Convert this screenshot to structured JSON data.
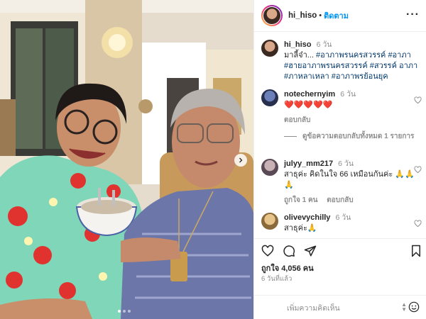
{
  "post": {
    "username": "hi_hiso",
    "follow_label": "ติดตาม",
    "separator": "•"
  },
  "caption": {
    "username": "hi_hiso",
    "time": "6 วัน",
    "text_prefix": "มาลี้จ๋า...",
    "hashtags": [
      "#อาภาพรนครสวรรค์",
      "#อาภา",
      "#ฮายอาภาพรนครสวรรค์",
      "#สวรรค์",
      "อาภา",
      "#ภาหลาเหลา",
      "#อาภาพรย้อนยุค"
    ]
  },
  "comments": [
    {
      "username": "notechernyim",
      "time": "6 วัน",
      "text": "❤️❤️❤️❤️❤️",
      "reply_label": "ตอบกลับ",
      "view_replies": "ดูข้อความตอบกลับทั้งหมด 1 รายการ"
    },
    {
      "username": "julyy_mm217",
      "time": "6 วัน",
      "text": "สาธุค่ะ คิดในใจ 66 เหมือนกันค่ะ 🙏🙏🙏",
      "likes": "ถูกใจ 1 คน",
      "reply_label": "ตอบกลับ"
    },
    {
      "username": "olivevychilly",
      "time": "6 วัน",
      "text": "สาธุค่ะ🙏"
    }
  ],
  "actions": {
    "likes_text": "ถูกใจ 4,056 คน",
    "posted_ago": "6 วันที่แล้ว"
  },
  "add_comment": {
    "placeholder": "เพิ่มความคิดเห็น"
  },
  "icons": {
    "more": "more-options-icon",
    "like": "heart-icon",
    "comment": "comment-icon",
    "share": "share-icon",
    "save": "bookmark-icon",
    "emoji": "emoji-icon"
  },
  "colors": {
    "accent": "#0095f6",
    "hashtag": "#00376b",
    "muted": "#8e8e8e",
    "heart": "#ed4956"
  }
}
